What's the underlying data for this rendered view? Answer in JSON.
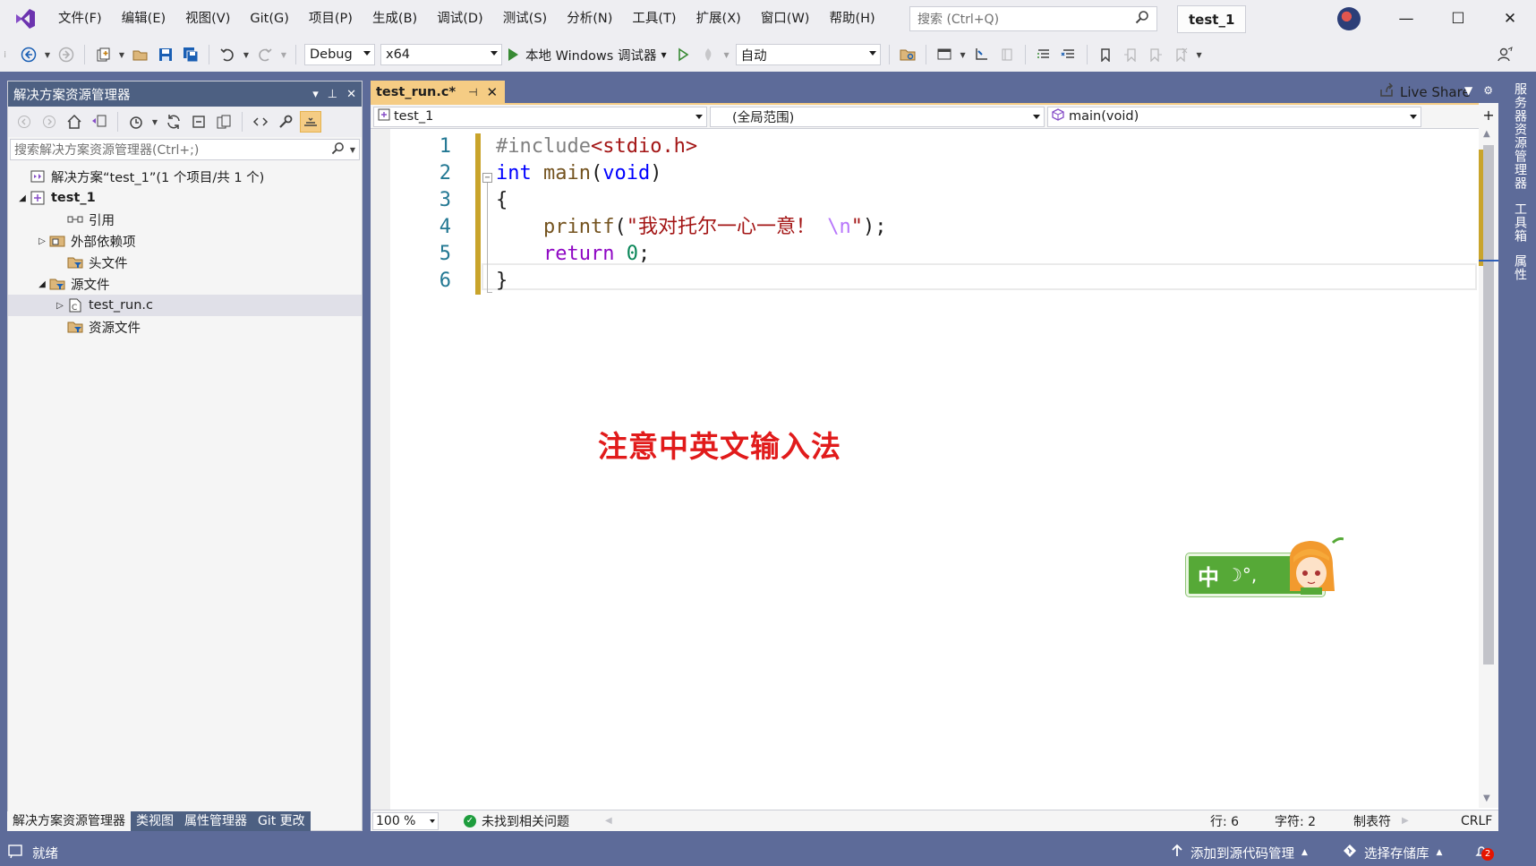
{
  "app": {
    "solution_name": "test_1",
    "window_controls": {
      "minimize": "—",
      "maximize": "☐",
      "close": "✕"
    }
  },
  "menu": {
    "items": [
      "文件(F)",
      "编辑(E)",
      "视图(V)",
      "Git(G)",
      "项目(P)",
      "生成(B)",
      "调试(D)",
      "测试(S)",
      "分析(N)",
      "工具(T)",
      "扩展(X)",
      "窗口(W)",
      "帮助(H)"
    ]
  },
  "search": {
    "placeholder": "搜索 (Ctrl+Q)"
  },
  "toolbar": {
    "configuration": "Debug",
    "platform": "x64",
    "debugger_label": "本地 Windows 调试器",
    "auto_combo": "自动",
    "live_share": "Live Share"
  },
  "solution_explorer": {
    "title": "解决方案资源管理器",
    "search_placeholder": "搜索解决方案资源管理器(Ctrl+;)",
    "tree": [
      {
        "label": "解决方案“test_1”(1 个项目/共 1 个)",
        "expander": "",
        "icon": "solution-icon"
      },
      {
        "label": "test_1",
        "expander": "◢",
        "icon": "project-icon"
      },
      {
        "label": "引用",
        "expander": "",
        "icon": "references-icon"
      },
      {
        "label": "外部依赖项",
        "expander": "▷",
        "icon": "external-deps-icon"
      },
      {
        "label": "头文件",
        "expander": "",
        "icon": "filter-folder-icon"
      },
      {
        "label": "源文件",
        "expander": "◢",
        "icon": "filter-folder-icon"
      },
      {
        "label": "test_run.c",
        "expander": "▷",
        "icon": "c-file-icon"
      },
      {
        "label": "资源文件",
        "expander": "",
        "icon": "filter-folder-icon"
      }
    ],
    "bottom_tabs": [
      "解决方案资源管理器",
      "类视图",
      "属性管理器",
      "Git 更改"
    ]
  },
  "editor": {
    "tab_title": "test_run.c*",
    "nav": {
      "project": "test_1",
      "scope": "(全局范围)",
      "member": "main(void)"
    },
    "lines": [
      {
        "n": "1",
        "parts": [
          [
            "pp",
            "#include"
          ],
          [
            "str",
            "<stdio.h>"
          ]
        ]
      },
      {
        "n": "2",
        "parts": [
          [
            "kw",
            "int"
          ],
          [
            "punct",
            " "
          ],
          [
            "fn",
            "main"
          ],
          [
            "punct",
            "("
          ],
          [
            "kw",
            "void"
          ],
          [
            "punct",
            ")"
          ]
        ]
      },
      {
        "n": "3",
        "parts": [
          [
            "punct",
            "{"
          ]
        ]
      },
      {
        "n": "4",
        "parts": [
          [
            "punct",
            "    "
          ],
          [
            "fn",
            "printf"
          ],
          [
            "punct",
            "("
          ],
          [
            "str",
            "\"我对托尔一心一意！ "
          ],
          [
            "esc",
            "\\n"
          ],
          [
            "str",
            "\""
          ],
          [
            "punct",
            ");"
          ]
        ]
      },
      {
        "n": "5",
        "parts": [
          [
            "punct",
            "    "
          ],
          [
            "ctl",
            "return"
          ],
          [
            "punct",
            " "
          ],
          [
            "num",
            "0"
          ],
          [
            "punct",
            ";"
          ]
        ]
      },
      {
        "n": "6",
        "parts": [
          [
            "punct",
            "}"
          ]
        ]
      }
    ],
    "annotation": "注意中英文输入法",
    "collapse_glyph": "−"
  },
  "editor_status": {
    "zoom": "100 %",
    "issues": "未找到相关问题",
    "line": "行: 6",
    "char": "字符: 2",
    "indent": "制表符",
    "eol": "CRLF"
  },
  "right_strip": {
    "tabs": [
      "服务器资源管理器",
      "工具箱",
      "属性"
    ]
  },
  "ime": {
    "mode": "中"
  },
  "statusbar": {
    "ready": "就绪",
    "add_source": "添加到源代码管理",
    "select_repo": "选择存储库",
    "notifications": "2"
  },
  "colors": {
    "accent": "#5d6b99",
    "tab_gold": "#f5cc84",
    "annotation_red": "#e11b1b",
    "ime_green": "#56a937"
  }
}
